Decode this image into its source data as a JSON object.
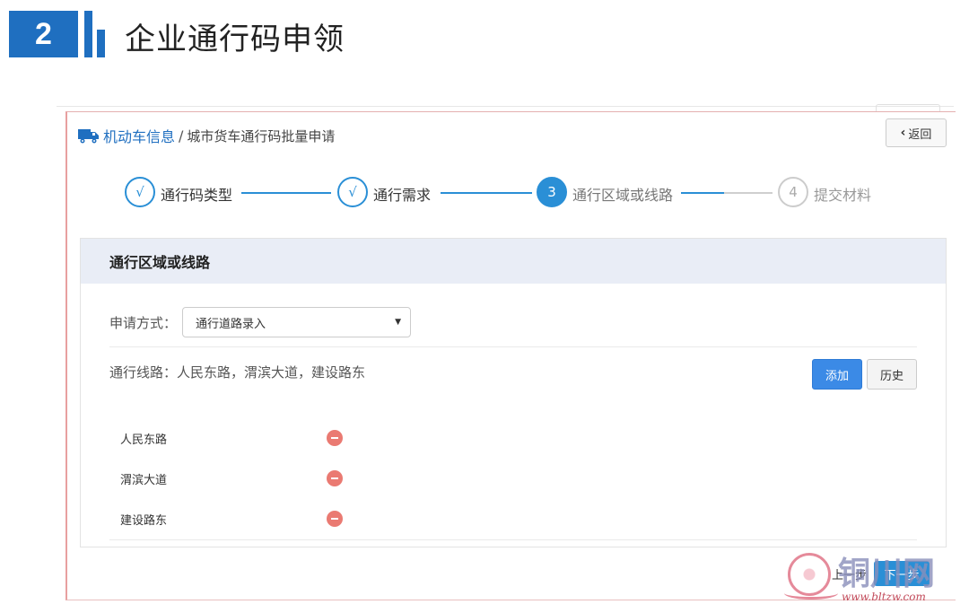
{
  "slide": {
    "number": "2",
    "title": "企业通行码申领"
  },
  "breadcrumb": {
    "root": "机动车信息",
    "separator": "/",
    "current": "城市货车通行码批量申请"
  },
  "back_button": {
    "icon": "chevron-left-icon",
    "label": "返回"
  },
  "steps": [
    {
      "index": "√",
      "label": "通行码类型",
      "state": "done"
    },
    {
      "index": "√",
      "label": "通行需求",
      "state": "done"
    },
    {
      "index": "3",
      "label": "通行区域或线路",
      "state": "active"
    },
    {
      "index": "4",
      "label": "提交材料",
      "state": "todo"
    }
  ],
  "panel": {
    "title": "通行区域或线路",
    "method_label": "申请方式：",
    "method_value": "通行道路录入",
    "route_text": "通行线路：人民东路，渭滨大道，建设路东",
    "add_label": "添加",
    "history_label": "历史",
    "roads": [
      "人民东路",
      "渭滨大道",
      "建设路东"
    ]
  },
  "footer": {
    "prev_label": "上一步",
    "next_label": "下一步"
  },
  "watermark": {
    "text": "铜川网",
    "url": "www.bltzw.com"
  },
  "colors": {
    "primary": "#2a8fd6",
    "slide_blue": "#1f6fc0",
    "remove": "#ea7a72",
    "panel_head": "#e9edf6"
  }
}
